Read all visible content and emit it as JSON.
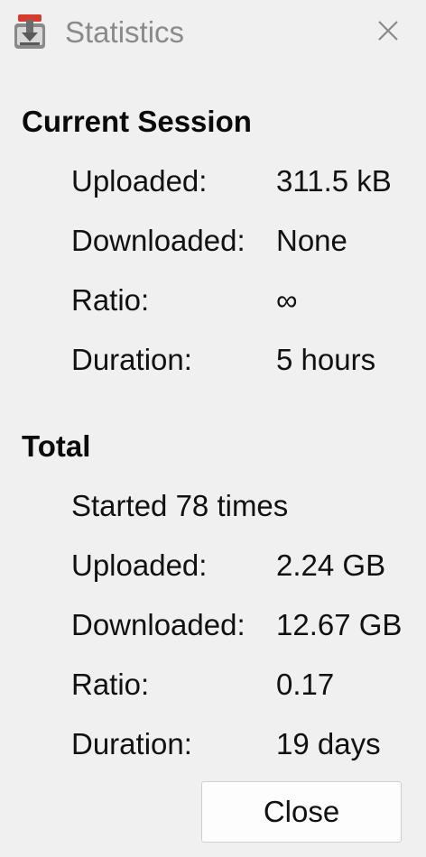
{
  "window": {
    "title": "Statistics",
    "app_icon": "transmission-icon",
    "close_icon": "close-icon"
  },
  "current_session": {
    "heading": "Current Session",
    "rows": [
      {
        "label": "Uploaded:",
        "value": "311.5 kB"
      },
      {
        "label": "Downloaded:",
        "value": "None"
      },
      {
        "label": "Ratio:",
        "value": "∞"
      },
      {
        "label": "Duration:",
        "value": "5 hours"
      }
    ]
  },
  "total": {
    "heading": "Total",
    "started": "Started 78 times",
    "rows": [
      {
        "label": "Uploaded:",
        "value": "2.24 GB"
      },
      {
        "label": "Downloaded:",
        "value": "12.67 GB"
      },
      {
        "label": "Ratio:",
        "value": "0.17"
      },
      {
        "label": "Duration:",
        "value": "19 days"
      }
    ]
  },
  "buttons": {
    "close_label": "Close"
  }
}
